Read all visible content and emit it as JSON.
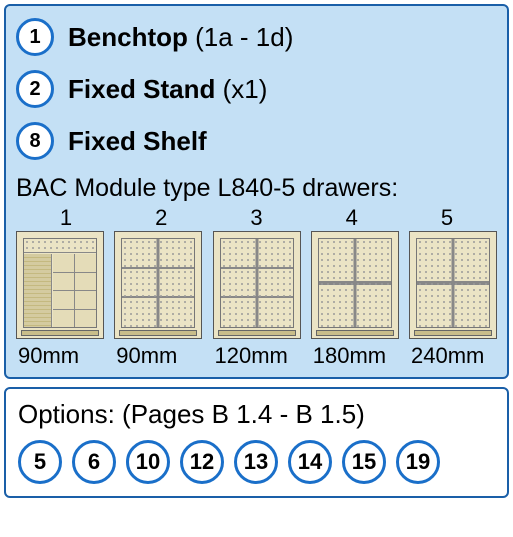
{
  "components": [
    {
      "num": "1",
      "bold": "Benchtop",
      "extra": " (1a - 1d)"
    },
    {
      "num": "2",
      "bold": "Fixed Stand",
      "extra": " (x1)"
    },
    {
      "num": "8",
      "bold": "Fixed Shelf",
      "extra": ""
    }
  ],
  "module_title": "BAC Module type L840-5 drawers:",
  "drawers": {
    "headers": [
      "1",
      "2",
      "3",
      "4",
      "5"
    ],
    "sizes": [
      "90mm",
      "90mm",
      "120mm",
      "180mm",
      "240mm"
    ]
  },
  "options": {
    "title": "Options: (Pages B 1.4 - B 1.5)",
    "items": [
      "5",
      "6",
      "10",
      "12",
      "13",
      "14",
      "15",
      "19"
    ]
  }
}
